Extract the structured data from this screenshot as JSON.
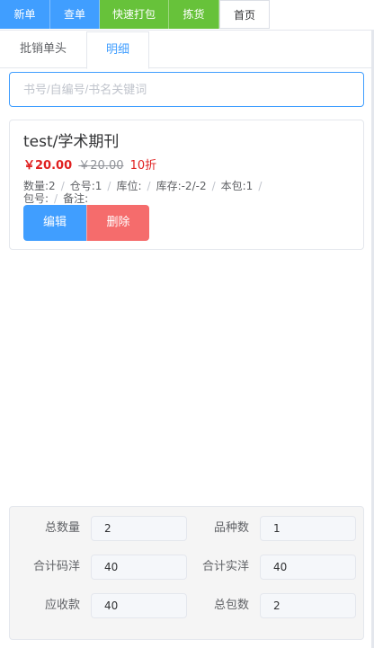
{
  "toolbar": {
    "new_order": "新单",
    "search_order": "查单",
    "quick_pack": "快速打包",
    "pick": "拣货",
    "home": "首页"
  },
  "tabs": {
    "header": "批销单头",
    "detail": "明细"
  },
  "search": {
    "placeholder": "书号/自编号/书名关键词",
    "value": ""
  },
  "item": {
    "title": "test/学术期刊",
    "price": "￥20.00",
    "original_price": "￥20.00",
    "discount": "10折",
    "quantity": "数量:2",
    "warehouse": "仓号:1",
    "location": "库位:",
    "stock": "库存:-2/-2",
    "pack": "本包:1",
    "pack_no": "包号:",
    "note": "备注:",
    "edit": "编辑",
    "delete": "删除"
  },
  "summary": {
    "total_qty_label": "总数量",
    "total_qty": "2",
    "kinds_label": "品种数",
    "kinds": "1",
    "list_total_label": "合计码洋",
    "list_total": "40",
    "actual_total_label": "合计实洋",
    "actual_total": "40",
    "receivable_label": "应收款",
    "receivable": "40",
    "packs_label": "总包数",
    "packs": "2"
  },
  "colors": {
    "primary": "#409eff",
    "success": "#67c23a",
    "danger": "#f56c6c",
    "price": "#e02020"
  }
}
